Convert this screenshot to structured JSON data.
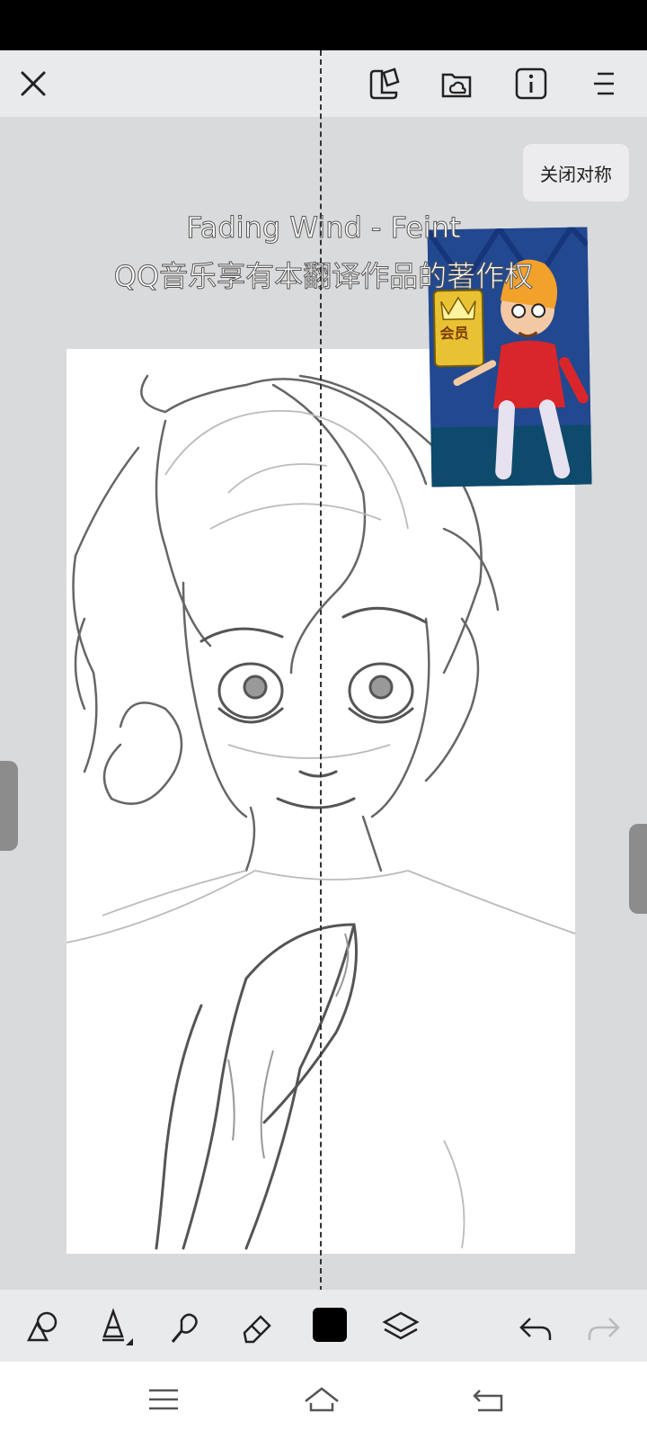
{
  "top_toolbar": {
    "close": "close-icon",
    "icons": [
      "reference-icon",
      "folder-cloud-icon",
      "info-icon",
      "menu-icon"
    ]
  },
  "symmetry": {
    "close_label": "关闭对称"
  },
  "lyrics": {
    "line1": "Fading Wind - Feint",
    "line2": "QQ音乐享有本翻译作品的著作权"
  },
  "ad": {
    "badge_text": "会员"
  },
  "bottom_toolbar": {
    "tools": [
      "shapes-icon",
      "brush-icon",
      "blur-icon",
      "eraser-icon",
      "color-swatch",
      "layers-icon",
      "undo-icon",
      "redo-icon"
    ],
    "current_color": "#000000",
    "redo_enabled": false
  },
  "nav": {
    "buttons": [
      "menu-icon",
      "home-icon",
      "back-icon"
    ]
  }
}
